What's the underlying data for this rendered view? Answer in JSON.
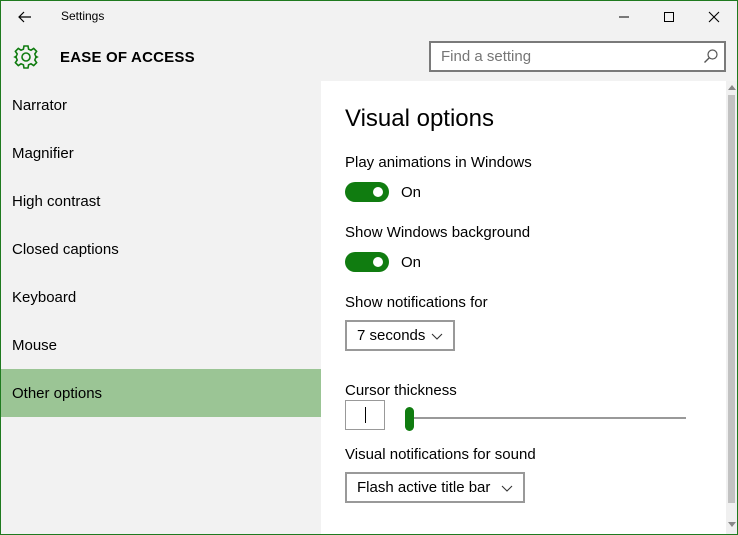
{
  "window": {
    "title": "Settings",
    "controls": [
      "minimize",
      "maximize",
      "close"
    ]
  },
  "header": {
    "section_title": "EASE OF ACCESS",
    "search_placeholder": "Find a setting"
  },
  "sidebar": {
    "items": [
      {
        "label": "Narrator",
        "selected": false
      },
      {
        "label": "Magnifier",
        "selected": false
      },
      {
        "label": "High contrast",
        "selected": false
      },
      {
        "label": "Closed captions",
        "selected": false
      },
      {
        "label": "Keyboard",
        "selected": false
      },
      {
        "label": "Mouse",
        "selected": false
      },
      {
        "label": "Other options",
        "selected": true
      }
    ]
  },
  "content": {
    "page_title": "Visual options",
    "play_animations": {
      "label": "Play animations in Windows",
      "state": "On"
    },
    "show_background": {
      "label": "Show Windows background",
      "state": "On"
    },
    "notifications": {
      "label": "Show notifications for",
      "value": "7 seconds"
    },
    "cursor_thickness": {
      "label": "Cursor thickness",
      "level": 0
    },
    "sound_notifications": {
      "label": "Visual notifications for sound",
      "value": "Flash active title bar"
    }
  },
  "colors": {
    "accent": "#107c10",
    "selected_item": "#9bc595",
    "window_border": "#1f7a1f"
  },
  "icons": [
    "back-arrow-icon",
    "minimize-icon",
    "maximize-icon",
    "close-icon",
    "gear-icon",
    "search-icon",
    "chevron-down-icon"
  ]
}
